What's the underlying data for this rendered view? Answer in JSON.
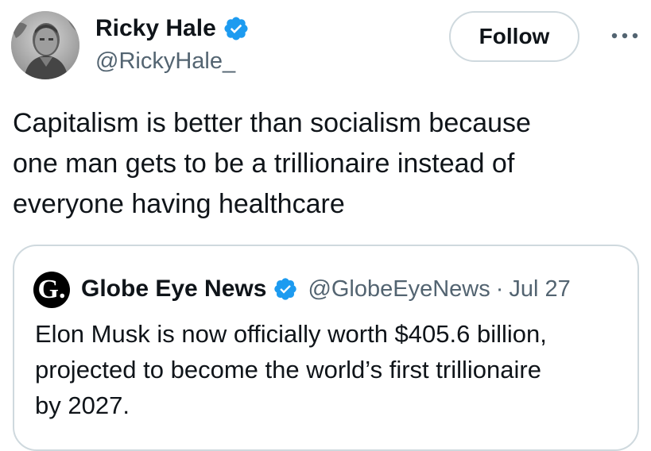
{
  "author": {
    "display_name": "Ricky Hale",
    "handle": "@RickyHale_",
    "verified_icon": "verified-badge-icon",
    "avatar_icon": "avatar-photo"
  },
  "actions": {
    "follow_label": "Follow",
    "more_icon": "more-options-icon"
  },
  "tweet": {
    "text": "Capitalism is better than socialism because\none man gets to be a trillionaire instead of\neveryone having healthcare"
  },
  "quote": {
    "avatar_letter": "G.",
    "display_name": "Globe Eye News",
    "handle": "@GlobeEyeNews",
    "separator": "·",
    "date": "Jul 27",
    "text": "Elon Musk is now officially worth $405.6 billion,\nprojected to become the world’s first trillionaire\nby 2027."
  },
  "colors": {
    "text_primary": "#0f1419",
    "text_secondary": "#536471",
    "border": "#cfd9de",
    "verified": "#1d9bf0",
    "background": "#ffffff"
  }
}
